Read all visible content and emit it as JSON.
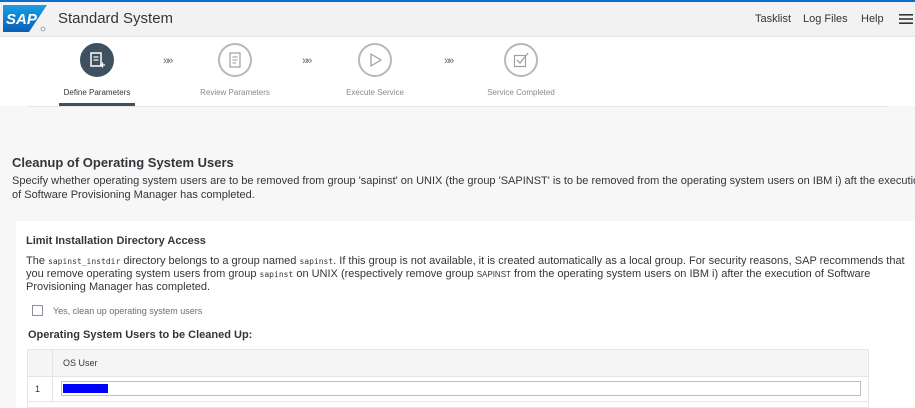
{
  "header": {
    "logo_text": "SAP",
    "app_title": "Standard System",
    "links": [
      "Tasklist",
      "Log Files",
      "Help"
    ],
    "menu_icon": "hamburger-icon",
    "accent_color": "#0a6ed1"
  },
  "roadmap": {
    "steps": [
      {
        "label": "Define Parameters",
        "icon": "form-edit-icon",
        "state": "active"
      },
      {
        "label": "Review Parameters",
        "icon": "document-icon",
        "state": "inactive"
      },
      {
        "label": "Execute Service",
        "icon": "play-icon",
        "state": "inactive"
      },
      {
        "label": "Service Completed",
        "icon": "checkbox-icon",
        "state": "inactive"
      }
    ],
    "separator": "»»",
    "active_color": "#3f5161"
  },
  "section": {
    "title": "Cleanup of Operating System Users",
    "description": "Specify whether operating system users are to be removed from group 'sapinst' on UNIX (the group 'SAPINST' is to be removed from the operating system users on IBM i) aft the execution of Software Provisioning Manager has completed."
  },
  "panel": {
    "title": "Limit Installation Directory Access",
    "desc": {
      "p1": "The ",
      "code1": "sapinst_instdir",
      "p2": " directory belongs to a group named ",
      "code2": "sapinst",
      "p3": ". If this group is not available, it is created automatically as a local group. For security reasons, SAP recommends that you remove operating system users from group ",
      "code3": "sapinst",
      "p4": " on UNIX (respectively remove group ",
      "code4": "SAPINST",
      "p5": " from the operating system users on IBM i) after the execution of Software Provisioning Manager has completed."
    },
    "checkbox": {
      "label": "Yes, clean up operating system users",
      "checked": false
    },
    "table": {
      "title": "Operating System Users to be Cleaned Up:",
      "column": "OS User",
      "rows": [
        {
          "num": "1",
          "value": ""
        }
      ],
      "selection_color": "#0000ff"
    }
  }
}
